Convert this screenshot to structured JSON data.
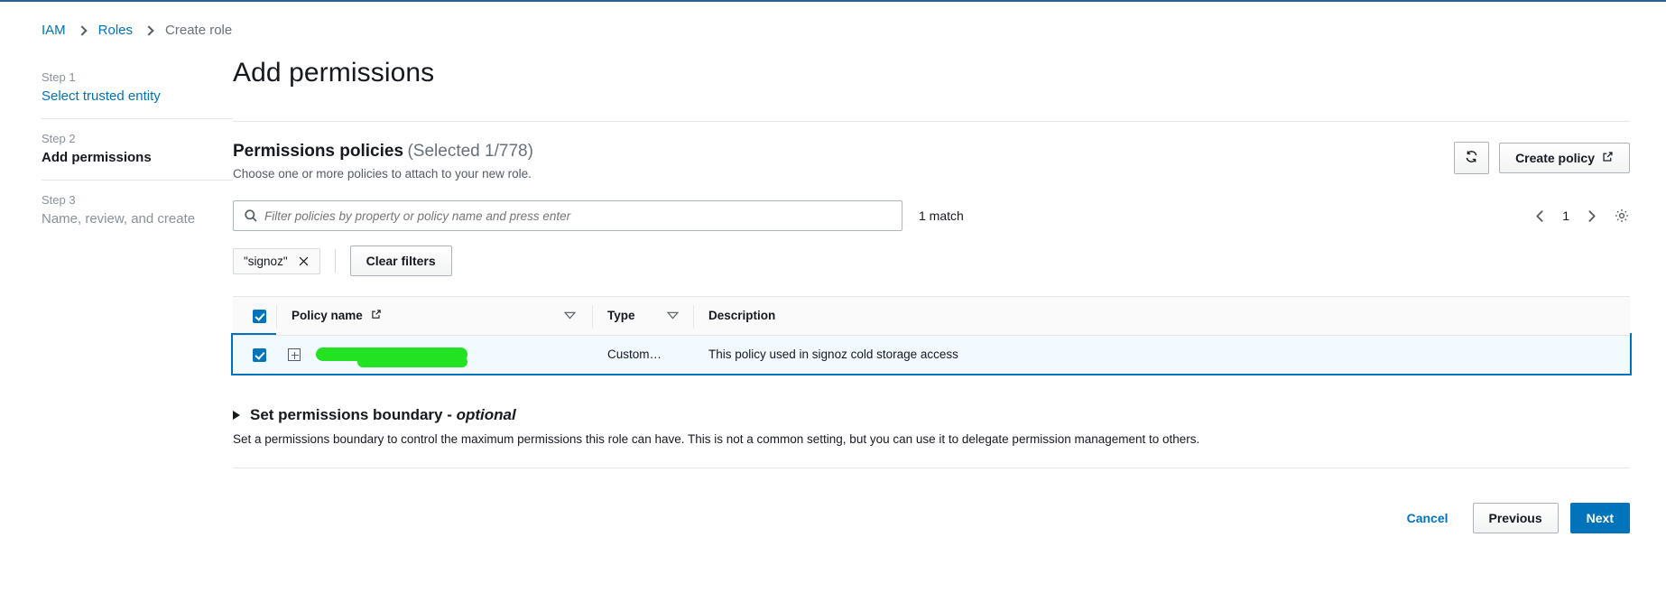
{
  "breadcrumb": {
    "items": [
      {
        "label": "IAM",
        "current": false
      },
      {
        "label": "Roles",
        "current": false
      },
      {
        "label": "Create role",
        "current": true
      }
    ]
  },
  "sidebar": {
    "steps": [
      {
        "num": "Step 1",
        "name": "Select trusted entity",
        "state": "done"
      },
      {
        "num": "Step 2",
        "name": "Add permissions",
        "state": "active"
      },
      {
        "num": "Step 3",
        "name": "Name, review, and create",
        "state": "future"
      }
    ]
  },
  "page": {
    "title": "Add permissions"
  },
  "panel": {
    "title": "Permissions policies",
    "count": "(Selected 1/778)",
    "subtitle": "Choose one or more policies to attach to your new role.",
    "refresh_icon": "refresh-icon",
    "create_policy_label": "Create policy",
    "external_link_icon": "external-link-icon"
  },
  "search": {
    "placeholder": "Filter policies by property or policy name and press enter",
    "value": "",
    "icon": "search-icon",
    "match_text": "1 match"
  },
  "pagination": {
    "prev_icon": "chevron-left-icon",
    "page": "1",
    "next_icon": "chevron-right-icon",
    "settings_icon": "gear-icon"
  },
  "filters": {
    "token_label": "\"signoz\"",
    "token_remove_icon": "close-icon",
    "clear_label": "Clear filters"
  },
  "table": {
    "columns": [
      {
        "label": "Policy name",
        "sortable": true,
        "external": true
      },
      {
        "label": "Type",
        "sortable": true,
        "external": false
      },
      {
        "label": "Description",
        "sortable": false,
        "external": false
      }
    ],
    "header_select_all": true,
    "sort_icon": "sort-descending-icon",
    "expand_icon": "expand-plus-icon",
    "rows": [
      {
        "selected": true,
        "name": "",
        "name_redacted": true,
        "type": "Custom…",
        "description": "This policy used in signoz cold storage access"
      }
    ]
  },
  "boundary": {
    "title": "Set permissions boundary - ",
    "title_optional": "optional",
    "toggle_icon": "triangle-right-icon",
    "description": "Set a permissions boundary to control the maximum permissions this role can have. This is not a common setting, but you can use it to delegate permission management to others."
  },
  "footer": {
    "cancel": "Cancel",
    "previous": "Previous",
    "next": "Next"
  }
}
